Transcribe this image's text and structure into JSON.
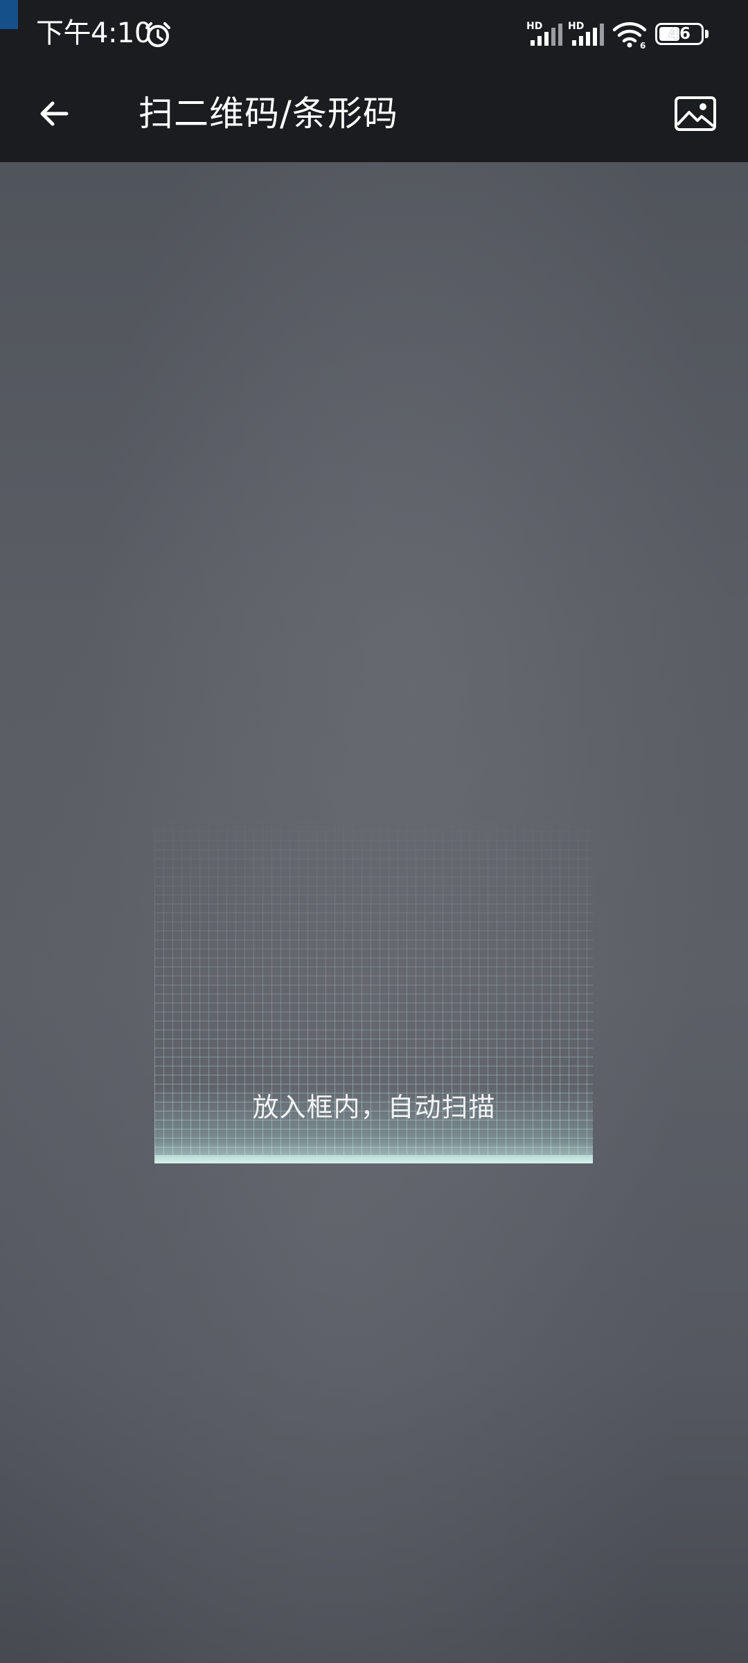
{
  "status_bar": {
    "time": "下午4:10",
    "alarm_icon": "alarm-clock-icon",
    "signal_1_label": "HD",
    "signal_2_label": "HD",
    "wifi_badge": "6",
    "battery_level": "46",
    "battery_fraction": 0.46
  },
  "app_bar": {
    "back_icon": "arrow-left-icon",
    "title": "扫二维码/条形码",
    "gallery_icon": "image-gallery-icon"
  },
  "scanner": {
    "hint": "放入框内，自动扫描"
  },
  "colors": {
    "bar_background": "#1b1c20",
    "camera_background": "#5a5d64",
    "scan_accent": "#bfe0db",
    "text": "#ffffff"
  }
}
